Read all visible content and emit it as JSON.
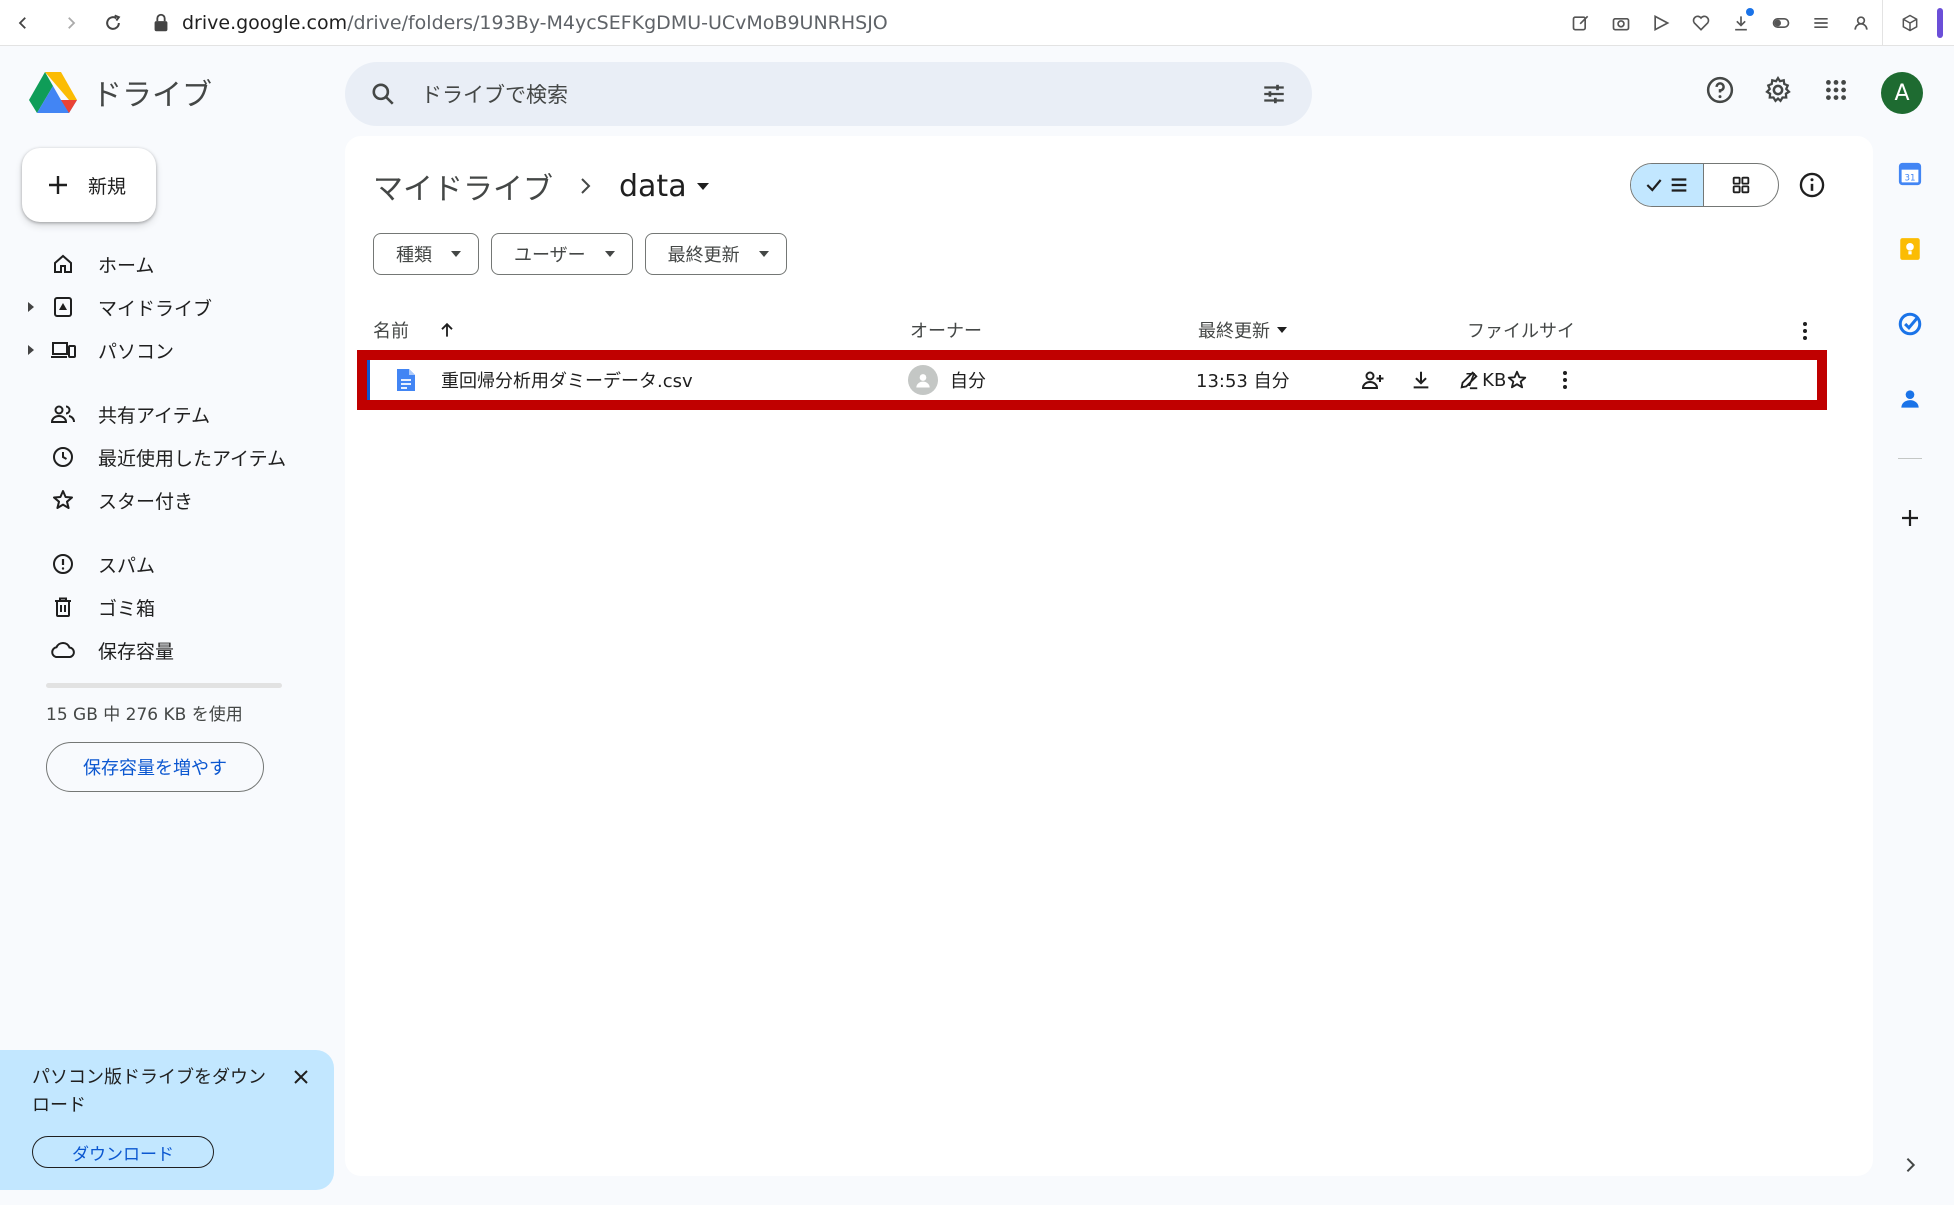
{
  "browser": {
    "url_host": "drive.google.com",
    "url_path": "/drive/folders/193By-M4ycSEFKgDMU-UCvMoB9UNRHSJO"
  },
  "app": {
    "name": "ドライブ"
  },
  "search": {
    "placeholder": "ドライブで検索"
  },
  "user": {
    "avatar_letter": "A"
  },
  "sidebar": {
    "new_label": "新規",
    "items": [
      {
        "label": "ホーム"
      },
      {
        "label": "マイドライブ"
      },
      {
        "label": "パソコン"
      },
      {
        "label": "共有アイテム"
      },
      {
        "label": "最近使用したアイテム"
      },
      {
        "label": "スター付き"
      },
      {
        "label": "スパム"
      },
      {
        "label": "ゴミ箱"
      },
      {
        "label": "保存容量"
      }
    ],
    "storage_text": "15 GB 中 276 KB を使用",
    "storage_used_fraction": 2e-05,
    "storage_button": "保存容量を増やす"
  },
  "promo": {
    "text": "パソコン版ドライブをダウンロード",
    "button": "ダウンロード"
  },
  "breadcrumb": {
    "root": "マイドライブ",
    "current": "data"
  },
  "filters": [
    "種類",
    "ユーザー",
    "最終更新"
  ],
  "columns": {
    "name": "名前",
    "owner": "オーナー",
    "modified": "最終更新",
    "size": "ファイルサイ"
  },
  "files": [
    {
      "name": "重回帰分析用ダミーデータ.csv",
      "owner": "自分",
      "modified": "13:53 自分",
      "size": "7 KB"
    }
  ],
  "colors": {
    "accent": "#0b57d0",
    "highlight_border": "#c00000",
    "selected_toggle": "#c2e7ff",
    "promo_bg": "#c2e7ff"
  }
}
